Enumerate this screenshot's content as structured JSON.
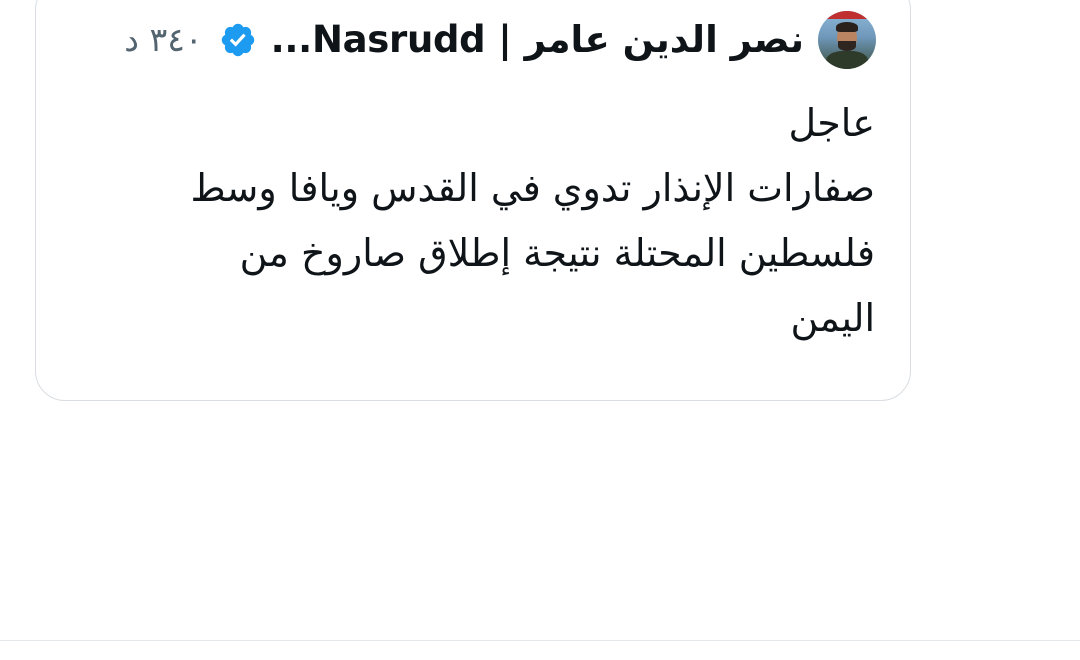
{
  "tweet": {
    "author_name": "نصر الدين عامر | Nasrudd...",
    "timestamp": "٣٤٠ د",
    "text_lines": [
      "عاجل",
      "صفارات الإنذار تدوي في القدس ويافا وسط",
      "فلسطين المحتلة نتيجة إطلاق صاروخ من",
      "اليمن"
    ]
  },
  "icons": {
    "verified": "verified-badge-icon",
    "verified_color": "#1d9bf0"
  }
}
